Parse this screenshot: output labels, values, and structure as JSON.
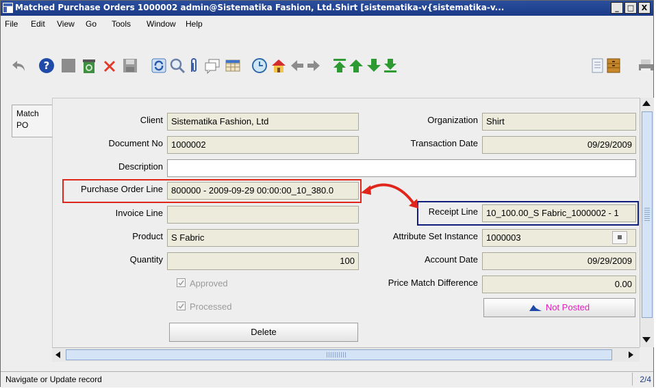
{
  "window": {
    "title": "Matched Purchase Orders  1000002  admin@Sistematika Fashion, Ltd.Shirt [sistematika-v{sistematika-v...",
    "minimize": "_",
    "maximize": "□",
    "close": "X"
  },
  "menu": {
    "file": "File",
    "edit": "Edit",
    "view": "View",
    "go": "Go",
    "tools": "Tools",
    "window": "Window",
    "help": "Help"
  },
  "tab": {
    "label": "Match PO"
  },
  "form": {
    "client_label": "Client",
    "client_value": "Sistematika Fashion, Ltd",
    "organization_label": "Organization",
    "organization_value": "Shirt",
    "document_no_label": "Document No",
    "document_no_value": "1000002",
    "transaction_date_label": "Transaction Date",
    "transaction_date_value": "09/29/2009",
    "description_label": "Description",
    "description_value": "",
    "po_line_label": "Purchase Order Line",
    "po_line_value": "800000 - 2009-09-29 00:00:00_10_380.0",
    "invoice_line_label": "Invoice Line",
    "invoice_line_value": "",
    "receipt_line_label": "Receipt Line",
    "receipt_line_value": "10_100.00_S Fabric_1000002 - 1",
    "product_label": "Product",
    "product_value": "S Fabric",
    "attr_set_label": "Attribute Set Instance",
    "attr_set_value": "1000003",
    "quantity_label": "Quantity",
    "quantity_value": "100",
    "account_date_label": "Account Date",
    "account_date_value": "09/29/2009",
    "price_match_label": "Price Match Difference",
    "price_match_value": "0.00",
    "approved_label": "Approved",
    "processed_label": "Processed",
    "not_posted_label": "Not Posted",
    "delete_label": "Delete"
  },
  "status": {
    "message": "Navigate or Update record",
    "page": "2/4"
  },
  "colors": {
    "title_bar": "#1b3a86",
    "field_readonly": "#ecebdc",
    "annotation_red": "#e0261b",
    "annotation_blue": "#101c7a",
    "not_posted_text": "#e020c0"
  }
}
